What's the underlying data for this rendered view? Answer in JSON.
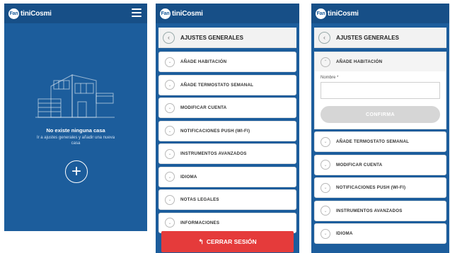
{
  "brand": {
    "name": "FantiniCosmi",
    "badge": "Fan",
    "name_rest": "tiniCosmi"
  },
  "home": {
    "empty_title": "No existe ninguna casa",
    "empty_subtitle": "Ir a ajustes generales y añadir una nueva casa",
    "add_button": "+"
  },
  "settings": {
    "title": "AJUSTES GENERALES",
    "back_icon": "‹",
    "items": [
      {
        "label": "AÑADE HABITACIÓN"
      },
      {
        "label": "AÑADE TERMOSTATO SEMANAL"
      },
      {
        "label": "MODIFICAR CUENTA"
      },
      {
        "label": "NOTIFICACIONES PUSH (WI-FI)"
      },
      {
        "label": "INSTRUMENTOS AVANZADOS"
      },
      {
        "label": "IDIOMA"
      },
      {
        "label": "NOTAS LEGALES"
      },
      {
        "label": "INFORMACIONES"
      }
    ],
    "logout": "CERRAR SESIÓN",
    "logout_icon": "↰"
  },
  "add_room": {
    "section_label": "AÑADE HABITACIÓN",
    "field_label": "Nombre *",
    "field_value": "",
    "confirm": "CONFIRMA",
    "items_after": [
      {
        "label": "AÑADE TERMOSTATO SEMANAL"
      },
      {
        "label": "MODIFICAR CUENTA"
      },
      {
        "label": "NOTIFICACIONES PUSH (WI-FI)"
      },
      {
        "label": "INSTRUMENTOS AVANZADOS"
      },
      {
        "label": "IDIOMA"
      }
    ]
  },
  "colors": {
    "primary": "#1c5d9c",
    "header": "#174f87",
    "logout": "#e53b3b",
    "disabled": "#d6d6d6"
  }
}
